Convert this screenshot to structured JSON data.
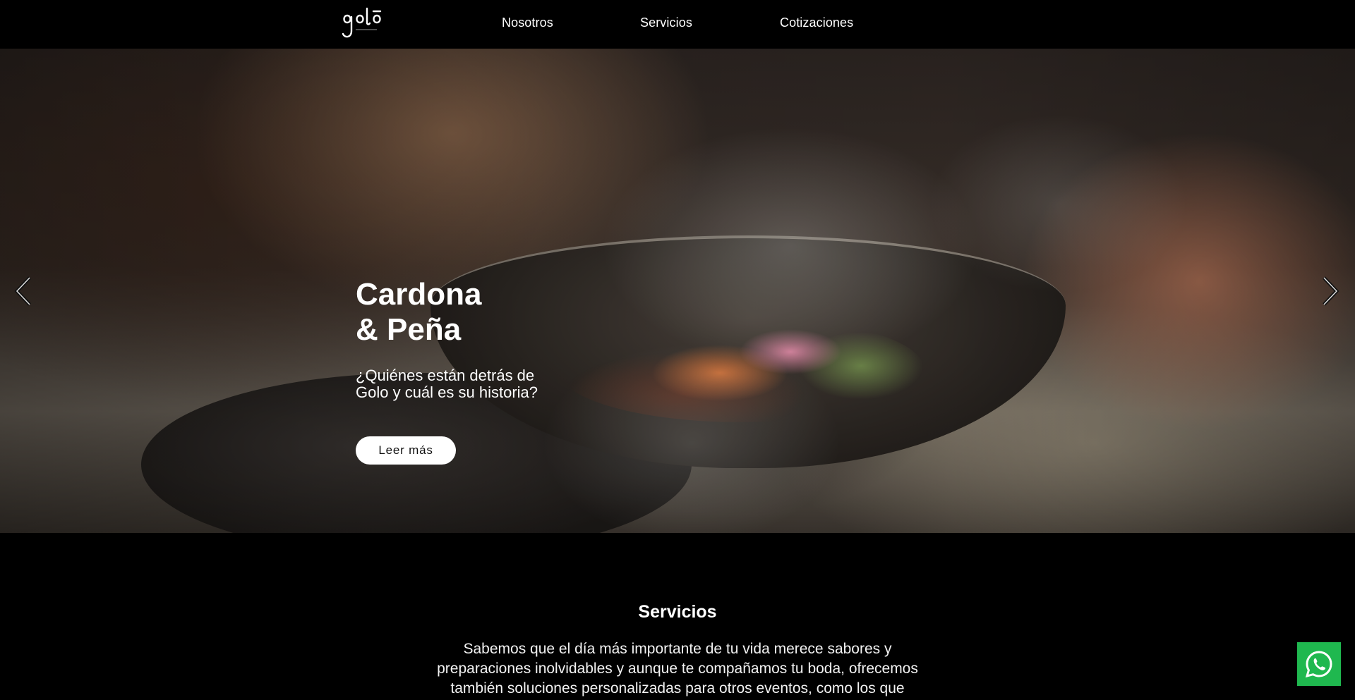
{
  "header": {
    "logo_name": "golo-logo",
    "nav": [
      {
        "label": "Nosotros"
      },
      {
        "label": "Servicios"
      },
      {
        "label": "Cotizaciones"
      }
    ]
  },
  "hero": {
    "title_line1": "Cardona",
    "title_line2": "& Peña",
    "subtitle": "¿Quiénes están detrás de Golo y cuál es su historia?",
    "button_label": "Leer más",
    "prev_icon": "chevron-left-icon",
    "next_icon": "chevron-right-icon"
  },
  "services": {
    "title": "Servicios",
    "text": "Sabemos que el día más importante de tu vida merece sabores y preparaciones inolvidables y aunque te compañamos tu boda, ofrecemos también soluciones personalizadas para otros eventos, como los que"
  },
  "floating": {
    "whatsapp_icon": "whatsapp-icon",
    "whatsapp_color": "#1fb84f"
  }
}
